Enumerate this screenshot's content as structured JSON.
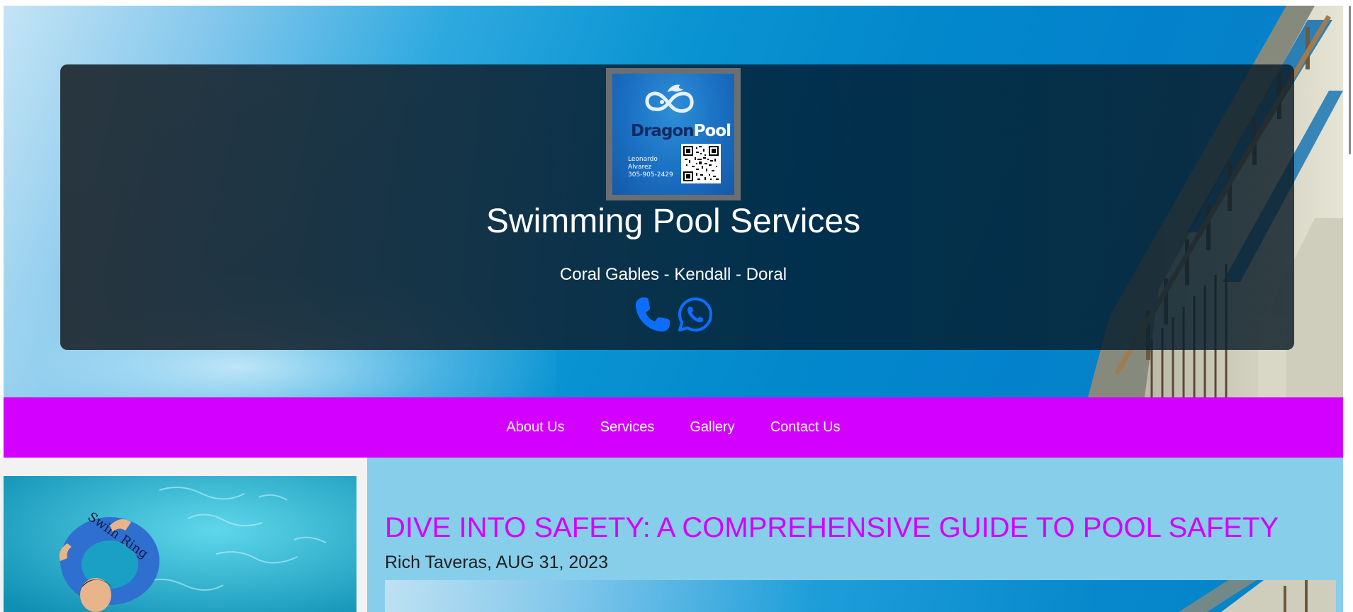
{
  "header": {
    "logo": {
      "brand_part1": "Dragon",
      "brand_part2": "Pool",
      "contact_name_line1": "Leonardo",
      "contact_name_line2": "Alvarez",
      "contact_phone": "305-905-2429",
      "qr_icon": "qr-code"
    },
    "title": "Swimming Pool Services",
    "subtitle": "Coral Gables - Kendall - Doral",
    "contact_icons": [
      "phone-icon",
      "whatsapp-icon"
    ]
  },
  "nav": {
    "items": [
      {
        "label": "About Us"
      },
      {
        "label": "Services"
      },
      {
        "label": "Gallery"
      },
      {
        "label": "Contact Us"
      }
    ]
  },
  "post": {
    "title": "DIVE INTO SAFETY: A COMPREHENSIVE GUIDE TO POOL SAFETY",
    "meta": "Rich Taveras, AUG 31, 2023",
    "thumbnail_ring_text": "Swim Ring"
  },
  "colors": {
    "nav_bg": "#d400ff",
    "post_title": "#d400ff",
    "main_bg": "#87ceeb",
    "icon_blue": "#0d6efd"
  }
}
